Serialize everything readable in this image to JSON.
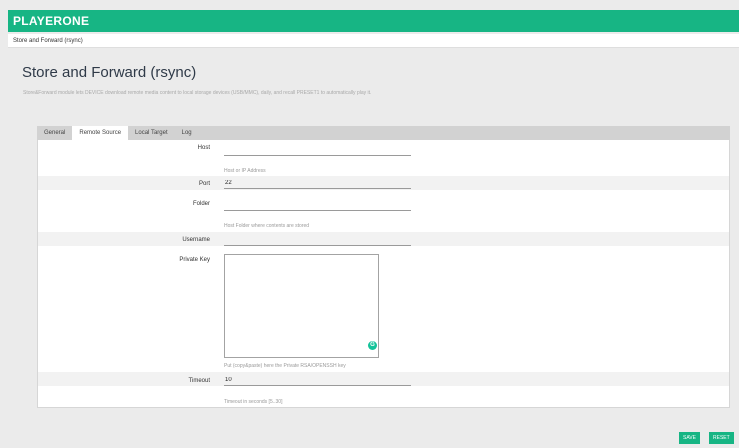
{
  "app": {
    "title": "PLAYERONE"
  },
  "breadcrumb": {
    "label": "Store and Forward (rsync)"
  },
  "page": {
    "title": "Store and Forward (rsync)",
    "description": "Store&Forward module lets DEVICE download remote media content to local storage devices (USB/MMC), daily, and recall PRESET1 to automatically play it."
  },
  "tabs": [
    {
      "label": "General",
      "active": false
    },
    {
      "label": "Remote Source",
      "active": true
    },
    {
      "label": "Local Target",
      "active": false
    },
    {
      "label": "Log",
      "active": false
    }
  ],
  "form": {
    "host": {
      "label": "Host",
      "value": "",
      "hint": "Host or IP Address"
    },
    "port": {
      "label": "Port",
      "value": "22"
    },
    "folder": {
      "label": "Folder",
      "value": "",
      "hint": "Host Folder where contents are stored"
    },
    "username": {
      "label": "Username",
      "value": ""
    },
    "private_key": {
      "label": "Private Key",
      "value": "",
      "hint": "Put (copy&paste) here the Private RSA/OPENSSH key"
    },
    "timeout": {
      "label": "Timeout",
      "value": "10",
      "hint": "Timeout in seconds [5..30]"
    }
  },
  "icons": {
    "grammarly": "grammarly-icon",
    "grammarly_glyph": "G"
  },
  "actions": {
    "save_label": "SAVE",
    "reset_label": "RESET"
  },
  "colors": {
    "accent": "#17b584",
    "stripe": "#f2f2f2",
    "tabbar": "#d2d2d2"
  }
}
